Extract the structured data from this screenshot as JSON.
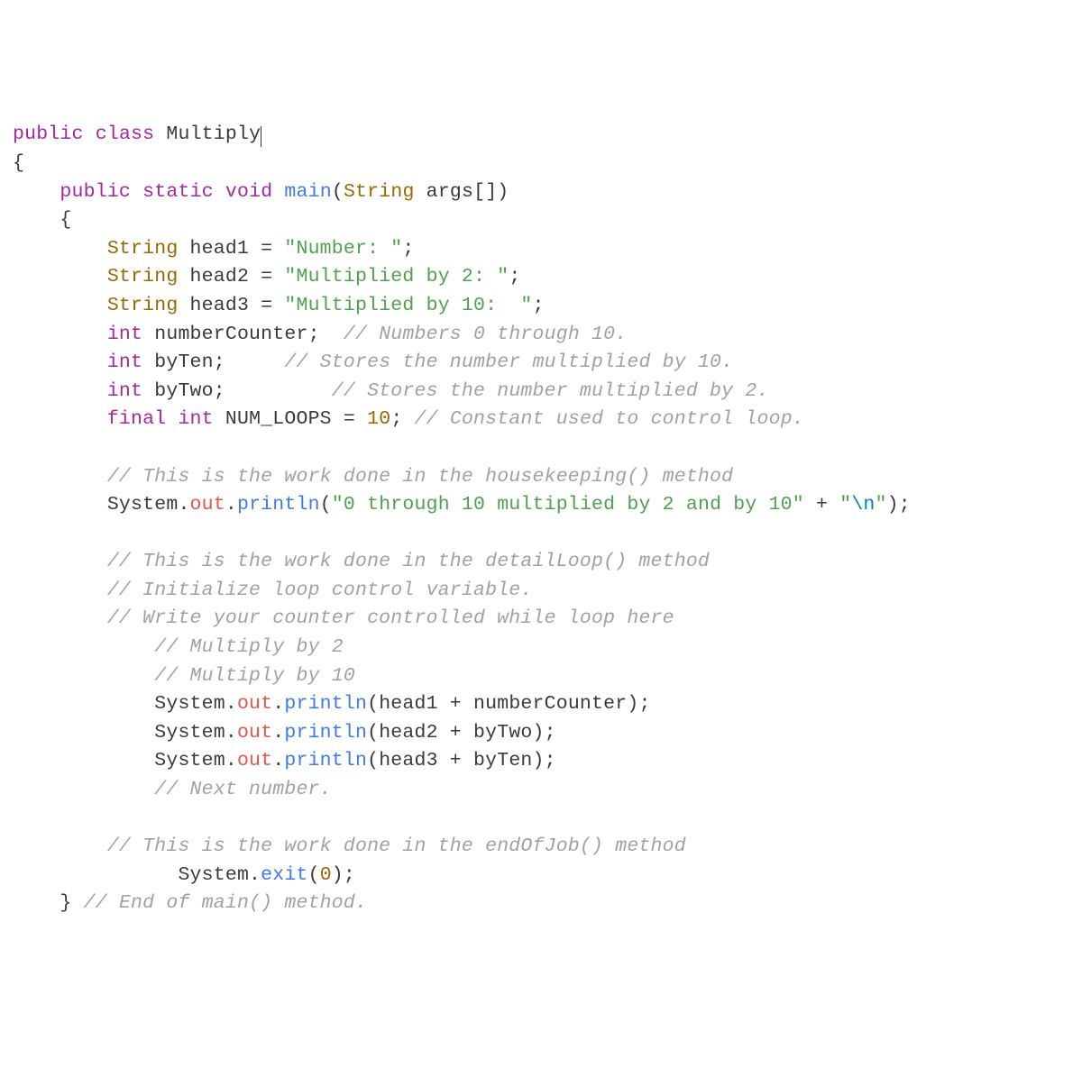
{
  "code": {
    "line1": {
      "kw1": "public",
      "kw2": "class",
      "cls": "Multiply"
    },
    "line2": "{",
    "line3": {
      "indent": "    ",
      "kw1": "public",
      "kw2": "static",
      "kw3": "void",
      "fn": "main",
      "p1": "(",
      "type": "String",
      "arg": " args[]",
      "p2": ")"
    },
    "line4": {
      "indent": "    ",
      "brace": "{"
    },
    "line5": {
      "indent": "        ",
      "type": "String",
      "rest": " head1 = ",
      "str": "\"Number: \"",
      "semi": ";"
    },
    "line6": {
      "indent": "        ",
      "type": "String",
      "rest": " head2 = ",
      "str": "\"Multiplied by 2: \"",
      "semi": ";"
    },
    "line7": {
      "indent": "        ",
      "type": "String",
      "rest": " head3 = ",
      "str": "\"Multiplied by 10:  \"",
      "semi": ";"
    },
    "line8": {
      "indent": "        ",
      "kw": "int",
      "rest": " numberCounter;  ",
      "cmt": "// Numbers 0 through 10."
    },
    "line9": {
      "indent": "        ",
      "kw": "int",
      "rest": " byTen;     ",
      "cmt": "// Stores the number multiplied by 10."
    },
    "line10": {
      "indent": "        ",
      "kw": "int",
      "rest": " byTwo;         ",
      "cmt": "// Stores the number multiplied by 2."
    },
    "line11": {
      "indent": "        ",
      "kw1": "final",
      "kw2": "int",
      "rest": " NUM_LOOPS = ",
      "num": "10",
      "semi": "; ",
      "cmt": "// Constant used to control loop."
    },
    "line12": "",
    "line13": {
      "indent": "        ",
      "cmt": "// This is the work done in the housekeeping() method"
    },
    "line14": {
      "indent": "        ",
      "a": "System.",
      "out": "out",
      "b": ".",
      "fn": "println",
      "p1": "(",
      "str1": "\"0 through 10 multiplied by 2 and by 10\"",
      "plus": " + ",
      "q1": "\"",
      "esc": "\\n",
      "q2": "\"",
      "p2": ");"
    },
    "line15": "",
    "line16": {
      "indent": "        ",
      "cmt": "// This is the work done in the detailLoop() method"
    },
    "line17": {
      "indent": "        ",
      "cmt": "// Initialize loop control variable."
    },
    "line18": {
      "indent": "        ",
      "cmt": "// Write your counter controlled while loop here"
    },
    "line19": {
      "indent": "            ",
      "cmt": "// Multiply by 2"
    },
    "line20": {
      "indent": "            ",
      "cmt": "// Multiply by 10"
    },
    "line21": {
      "indent": "            ",
      "a": "System.",
      "out": "out",
      "b": ".",
      "fn": "println",
      "rest": "(head1 + numberCounter);"
    },
    "line22": {
      "indent": "            ",
      "a": "System.",
      "out": "out",
      "b": ".",
      "fn": "println",
      "rest": "(head2 + byTwo);"
    },
    "line23": {
      "indent": "            ",
      "a": "System.",
      "out": "out",
      "b": ".",
      "fn": "println",
      "rest": "(head3 + byTen);"
    },
    "line24": {
      "indent": "            ",
      "cmt": "// Next number."
    },
    "line25": "",
    "line26": {
      "indent": "        ",
      "cmt": "// This is the work done in the endOfJob() method"
    },
    "line27": {
      "indent": "              ",
      "a": "System.",
      "fn": "exit",
      "p1": "(",
      "num": "0",
      "p2": ");"
    },
    "line28": {
      "indent": "    ",
      "brace": "} ",
      "cmt": "// End of main() method."
    }
  }
}
